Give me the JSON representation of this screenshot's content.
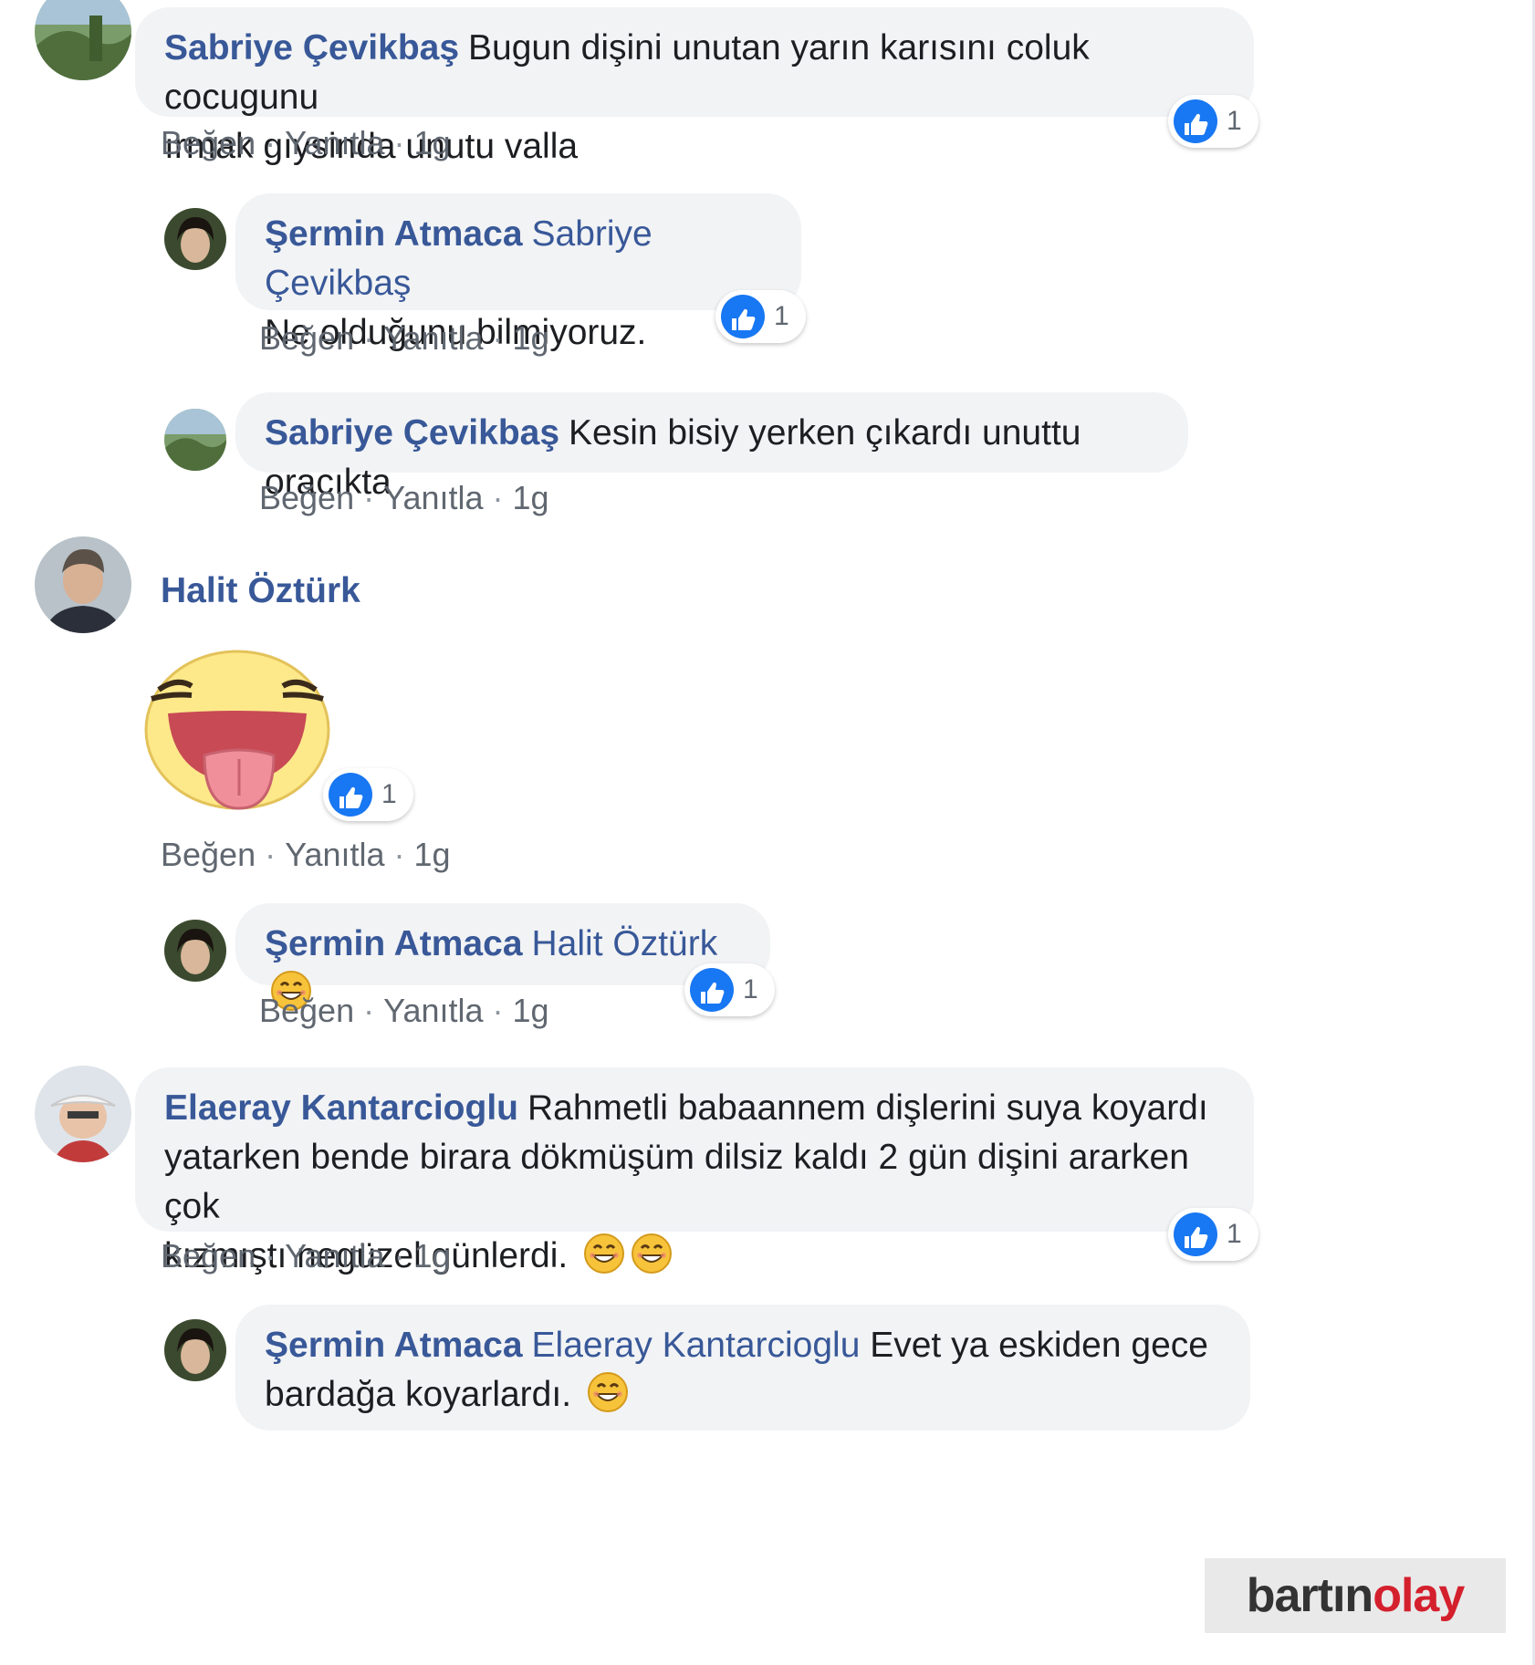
{
  "actions": {
    "like": "Beğen",
    "reply": "Yanıtla",
    "time": "1g",
    "separator": "·"
  },
  "comments": [
    {
      "author": "Sabriye Çevikbaş",
      "text_lines": [
        "Bugun dişini unutan yarın karısını coluk cocugunu",
        "ırmak gıysinda unutu valla"
      ],
      "likes": "1"
    },
    {
      "author": "Şermin Atmaca",
      "mention": "Sabriye Çevikbaş",
      "text": "Ne olduğunu bilmiyoruz.",
      "likes": "1"
    },
    {
      "author": "Sabriye Çevikbaş",
      "text": "Kesin bisiy yerken çıkardı unuttu oracıkta"
    },
    {
      "author": "Halit Öztürk",
      "sticker": "laughing-tongue-sticker",
      "likes": "1"
    },
    {
      "author": "Şermin Atmaca",
      "mention": "Halit Öztürk",
      "emoji": "smile-emoji",
      "likes": "1"
    },
    {
      "author": "Elaeray Kantarcioglu",
      "text_lines": [
        "Rahmetli babaannem dişlerini suya koyardı",
        "yatarken bende birara dökmüşüm dilsiz kaldı 2 gün dişini ararken çok",
        "kızmıştı negüzel günlerdi."
      ],
      "emoji": "grin-emoji",
      "likes": "1"
    },
    {
      "author": "Şermin Atmaca",
      "mention": "Elaeray Kantarcioglu",
      "text_lines": [
        "Evet ya eskiden gece",
        "bardağa koyarlardı."
      ],
      "emoji": "smile-emoji"
    }
  ],
  "watermark": {
    "part1": "bartın",
    "part2": "olay"
  },
  "colors": {
    "author": "#385898",
    "like_blue": "#1877f2",
    "bubble_bg": "#f2f3f5",
    "meta": "#606770"
  }
}
